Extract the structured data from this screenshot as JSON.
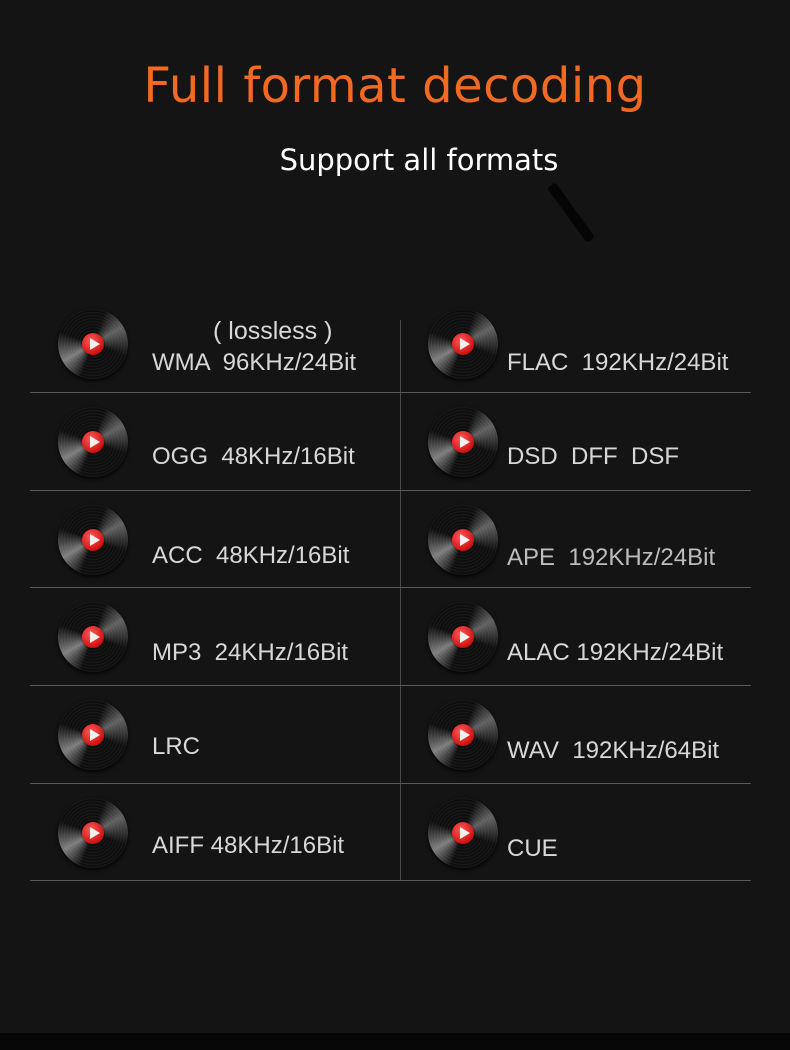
{
  "header": {
    "title": "Full format decoding",
    "subtitle": "Support all formats"
  },
  "colors": {
    "background": "#141414",
    "title": "#f26a21",
    "subtitle": "#ffffff",
    "text": "#d8d8d8",
    "accent_red": "#d01010"
  },
  "formats": {
    "left": [
      {
        "icon": "vinyl-play-icon",
        "note": "( lossless )",
        "label": "WMA  96KHz/24Bit"
      },
      {
        "icon": "vinyl-play-icon",
        "label": "OGG  48KHz/16Bit"
      },
      {
        "icon": "vinyl-play-icon",
        "label": "ACC  48KHz/16Bit"
      },
      {
        "icon": "vinyl-play-icon",
        "label": "MP3  24KHz/16Bit"
      },
      {
        "icon": "vinyl-play-icon",
        "label": "LRC"
      },
      {
        "icon": "vinyl-play-icon",
        "label": "AIFF 48KHz/16Bit"
      }
    ],
    "right": [
      {
        "icon": "vinyl-play-icon",
        "label": "FLAC  192KHz/24Bit"
      },
      {
        "icon": "vinyl-play-icon",
        "label": "DSD  DFF  DSF"
      },
      {
        "icon": "vinyl-play-icon",
        "label": "APE  192KHz/24Bit"
      },
      {
        "icon": "vinyl-play-icon",
        "label": "ALAC 192KHz/24Bit"
      },
      {
        "icon": "vinyl-play-icon",
        "label": "WAV  192KHz/64Bit"
      },
      {
        "icon": "vinyl-play-icon",
        "label": "CUE"
      }
    ]
  }
}
